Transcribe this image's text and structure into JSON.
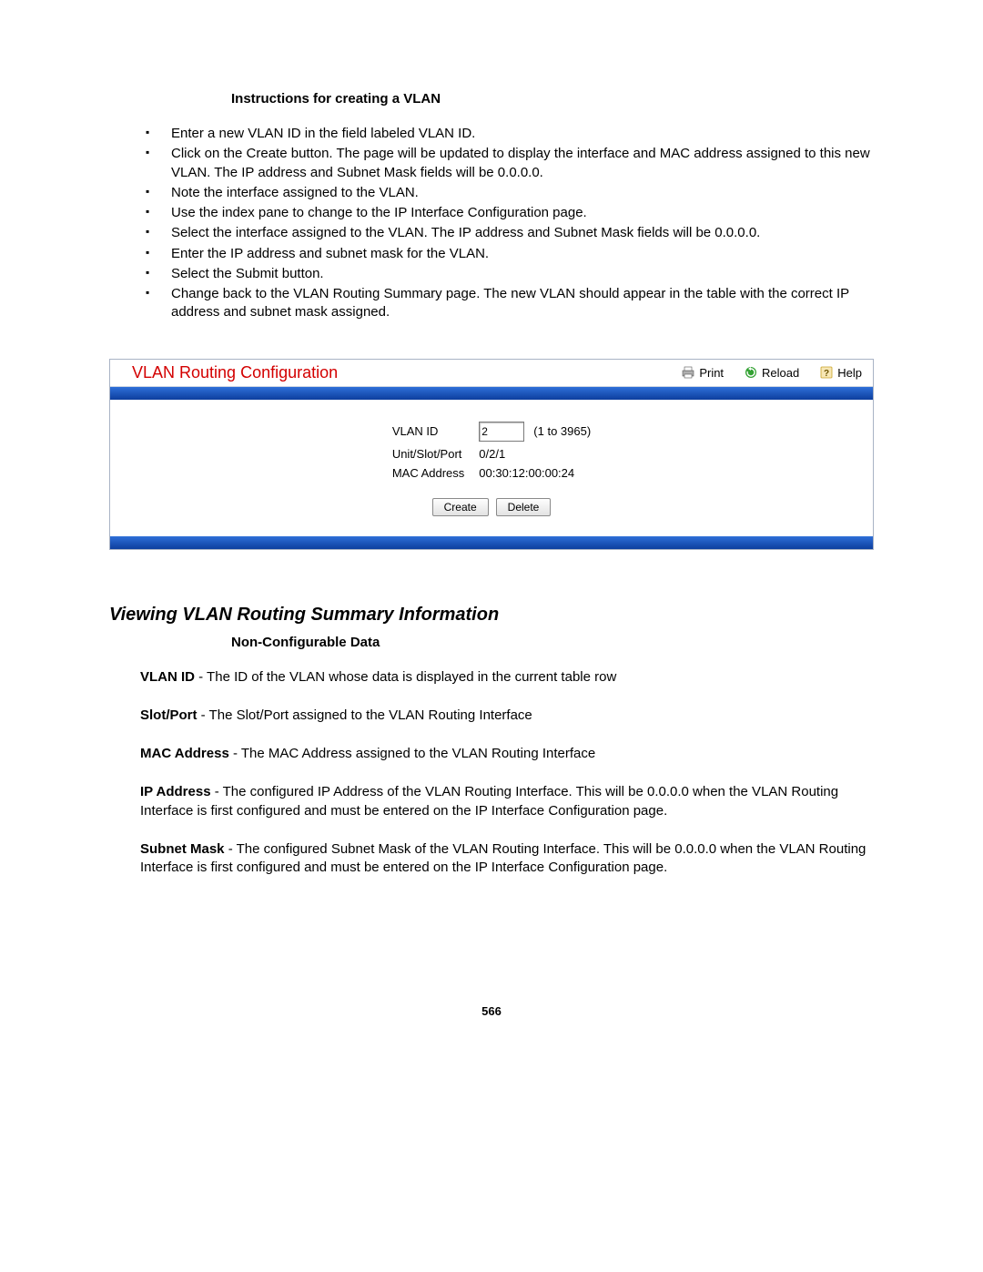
{
  "instructions": {
    "title": "Instructions for creating a VLAN",
    "items": [
      "Enter a new VLAN ID in the field labeled VLAN ID.",
      "Click on the Create button. The page will be updated to display the interface and MAC address assigned to this new VLAN. The IP address and Subnet Mask fields will be 0.0.0.0.",
      "Note the interface assigned to the VLAN.",
      "Use the index pane to change to the IP Interface Configuration page.",
      "Select the interface assigned to the VLAN. The IP address and Subnet Mask fields will be 0.0.0.0.",
      "Enter the IP address and subnet mask for the VLAN.",
      "Select the Submit button.",
      "Change back to the VLAN Routing Summary page. The new VLAN should appear in the table with the correct IP address and subnet mask assigned."
    ]
  },
  "panel": {
    "title": "VLAN Routing Configuration",
    "actions": {
      "print": "Print",
      "reload": "Reload",
      "help": "Help"
    },
    "form": {
      "vlan_id_label": "VLAN ID",
      "vlan_id_value": "2",
      "vlan_id_range": "(1 to 3965)",
      "usp_label": "Unit/Slot/Port",
      "usp_value": "0/2/1",
      "mac_label": "MAC Address",
      "mac_value": "00:30:12:00:00:24"
    },
    "buttons": {
      "create": "Create",
      "delete": "Delete"
    }
  },
  "summary": {
    "heading": "Viewing VLAN Routing Summary Information",
    "subheading": "Non-Configurable Data",
    "defs": [
      {
        "term": "VLAN ID",
        "text": " - The ID of the VLAN whose data is displayed in the current table row"
      },
      {
        "term": "Slot/Port",
        "text": " - The Slot/Port assigned to the VLAN Routing Interface"
      },
      {
        "term": "MAC Address",
        "text": " - The MAC Address assigned to the VLAN Routing Interface"
      },
      {
        "term": "IP Address",
        "text": " - The configured IP Address of the VLAN Routing Interface. This will be 0.0.0.0 when the VLAN Routing Interface is first configured and must be entered on the IP Interface Configuration page."
      },
      {
        "term": "Subnet Mask",
        "text": " - The configured Subnet Mask of the VLAN Routing Interface. This will be 0.0.0.0 when the VLAN Routing Interface is first configured and must be entered on the IP Interface Configuration page."
      }
    ]
  },
  "page_number": "566"
}
